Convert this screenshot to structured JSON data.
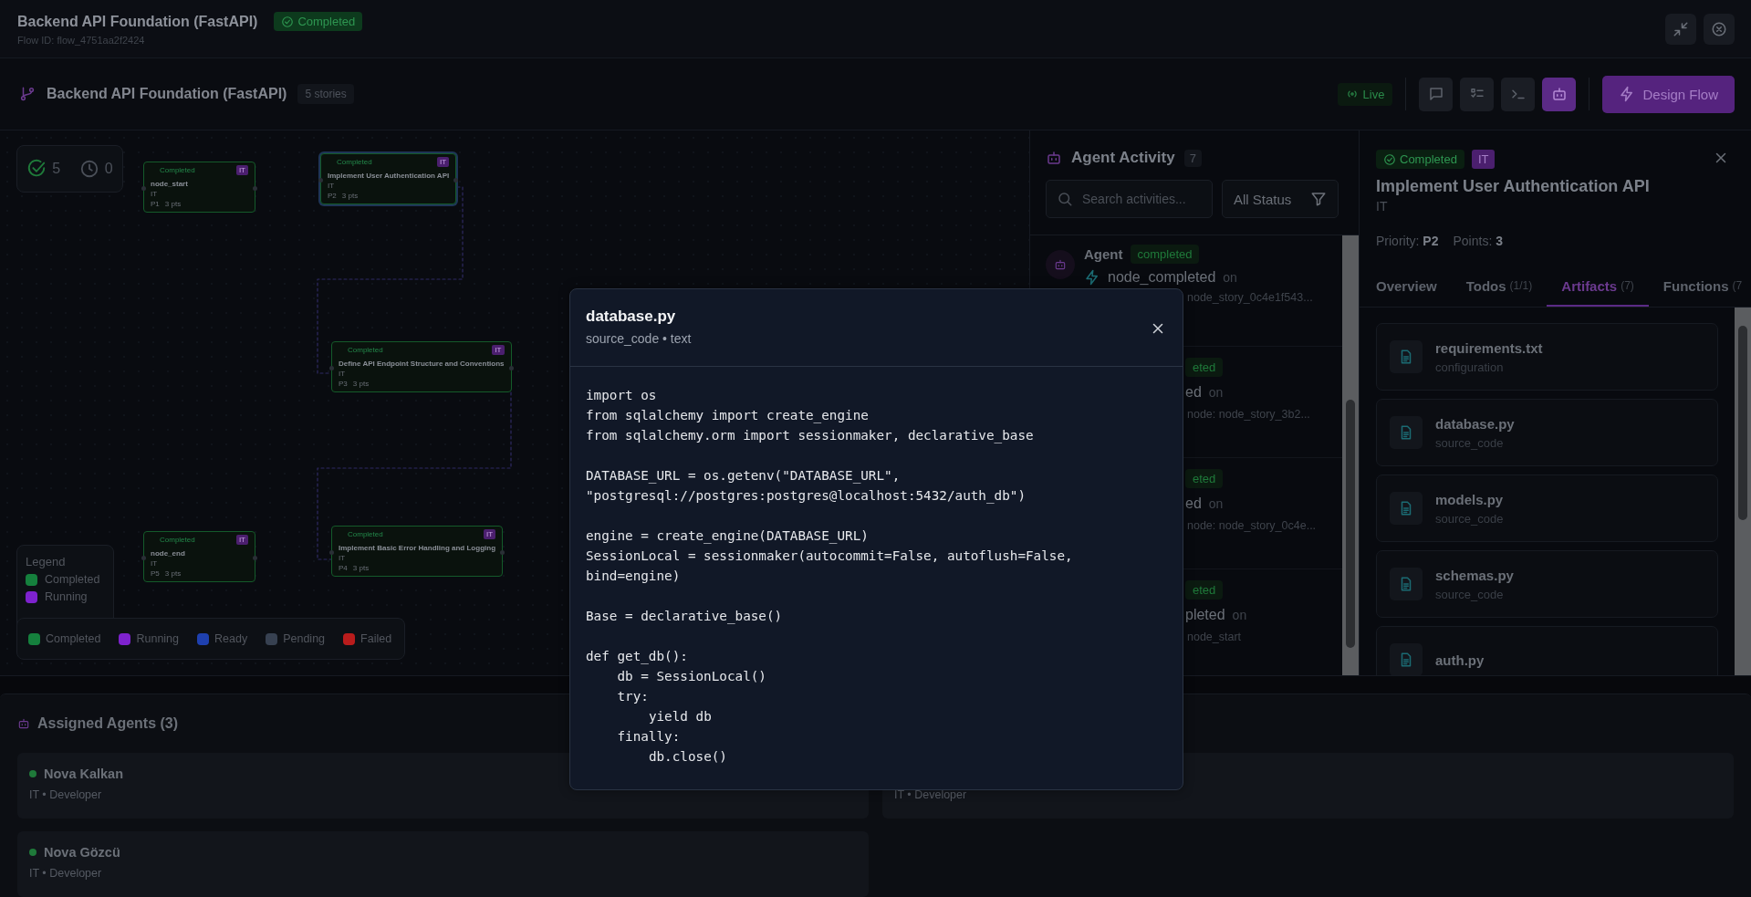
{
  "header": {
    "title": "Backend API Foundation (FastAPI)",
    "status": "Completed",
    "flow_id": "Flow ID: flow_4751aa2f2424"
  },
  "toolbar": {
    "title": "Backend API Foundation (FastAPI)",
    "stories": "5 stories",
    "live": "Live",
    "views": [
      {
        "kind": "chat",
        "selected": false
      },
      {
        "kind": "checklist",
        "selected": false
      },
      {
        "kind": "terminal",
        "selected": false
      },
      {
        "kind": "bot",
        "selected": true
      }
    ],
    "action": "Design Flow"
  },
  "canvas": {
    "stats": [
      {
        "kind": "done",
        "value": "5"
      },
      {
        "kind": "waiting",
        "value": "0"
      }
    ],
    "nodes": [
      {
        "status": "Completed",
        "tag": "IT",
        "title": "node_start",
        "department": "IT",
        "priority": "P1",
        "points": "3 pts",
        "selected": false
      },
      {
        "status": "Completed",
        "tag": "IT",
        "title": "Implement User Authentication API",
        "department": "IT",
        "priority": "P2",
        "points": "3 pts",
        "selected": true
      },
      {
        "status": "Completed",
        "tag": "IT",
        "title": "Define API Endpoint Structure and Conventions",
        "department": "IT",
        "priority": "P3",
        "points": "3 pts",
        "selected": false
      },
      {
        "status": "Completed",
        "tag": "IT",
        "title": "Implement Basic Error Handling and Logging",
        "department": "IT",
        "priority": "P4",
        "points": "3 pts",
        "selected": false
      },
      {
        "status": "Completed",
        "tag": "IT",
        "title": "node_end",
        "department": "IT",
        "priority": "P5",
        "points": "3 pts",
        "selected": false
      }
    ],
    "legend": {
      "title": "Legend",
      "items": [
        {
          "label": "Completed",
          "color": "#15803d"
        },
        {
          "label": "Running",
          "color": "#7e22ce"
        }
      ]
    },
    "status_legend": [
      {
        "label": "Completed",
        "color": "#15803d"
      },
      {
        "label": "Running",
        "color": "#7e22ce"
      },
      {
        "label": "Ready",
        "color": "#1e40af"
      },
      {
        "label": "Pending",
        "color": "#374151"
      },
      {
        "label": "Failed",
        "color": "#b91c1c"
      }
    ]
  },
  "activity": {
    "title": "Agent Activity",
    "count": "7",
    "search_placeholder": "Search activities...",
    "filter": "All Status",
    "items": [
      {
        "kind": "full",
        "agent": "Agent",
        "status": "completed",
        "event": "node_completed",
        "on": "on",
        "detail": "node_story_0c4e1f543..."
      },
      {
        "kind": "partial",
        "status": "eted",
        "event": "ed",
        "on": "on",
        "detail": "node: node_story_3b2..."
      },
      {
        "kind": "partial",
        "status": "eted",
        "event": "ed",
        "on": "on",
        "detail": "node: node_story_0c4e..."
      },
      {
        "kind": "partial",
        "status": "eted",
        "event": "pleted",
        "on": "on",
        "detail": "node_start"
      }
    ]
  },
  "detail": {
    "status": "Completed",
    "tag": "IT",
    "title": "Implement User Authentication API",
    "department": "IT",
    "priority": "Priority: **P2**",
    "points": "Points: **3**",
    "tabs": [
      {
        "label": "Overview",
        "selected": false
      },
      {
        "label": "Todos",
        "count": "(1/1)",
        "selected": false
      },
      {
        "label": "Artifacts",
        "count": "(7)",
        "selected": true
      },
      {
        "label": "Functions",
        "count": "(7",
        "selected": false
      }
    ],
    "artifacts": [
      {
        "name": "requirements.txt",
        "type": "configuration"
      },
      {
        "name": "database.py",
        "type": "source_code"
      },
      {
        "name": "models.py",
        "type": "source_code"
      },
      {
        "name": "schemas.py",
        "type": "source_code"
      },
      {
        "name": "auth.py"
      }
    ]
  },
  "agents": {
    "title": "Assigned Agents (3)",
    "items": [
      {
        "name": "Nova Kalkan",
        "role": "IT • Developer",
        "online": true
      },
      {
        "role": "IT • Developer"
      },
      {
        "name": "Nova Gözcü",
        "role": "IT • Developer",
        "online": true
      }
    ]
  },
  "modal": {
    "title": "database.py",
    "subtitle": "source_code • text",
    "code": "import os\nfrom sqlalchemy import create_engine\nfrom sqlalchemy.orm import sessionmaker, declarative_base\n\nDATABASE_URL = os.getenv(\"DATABASE_URL\",\n\"postgresql://postgres:postgres@localhost:5432/auth_db\")\n\nengine = create_engine(DATABASE_URL)\nSessionLocal = sessionmaker(autocommit=False, autoflush=False,\nbind=engine)\n\nBase = declarative_base()\n\ndef get_db():\n    db = SessionLocal()\n    try:\n        yield db\n    finally:\n        db.close()"
  }
}
